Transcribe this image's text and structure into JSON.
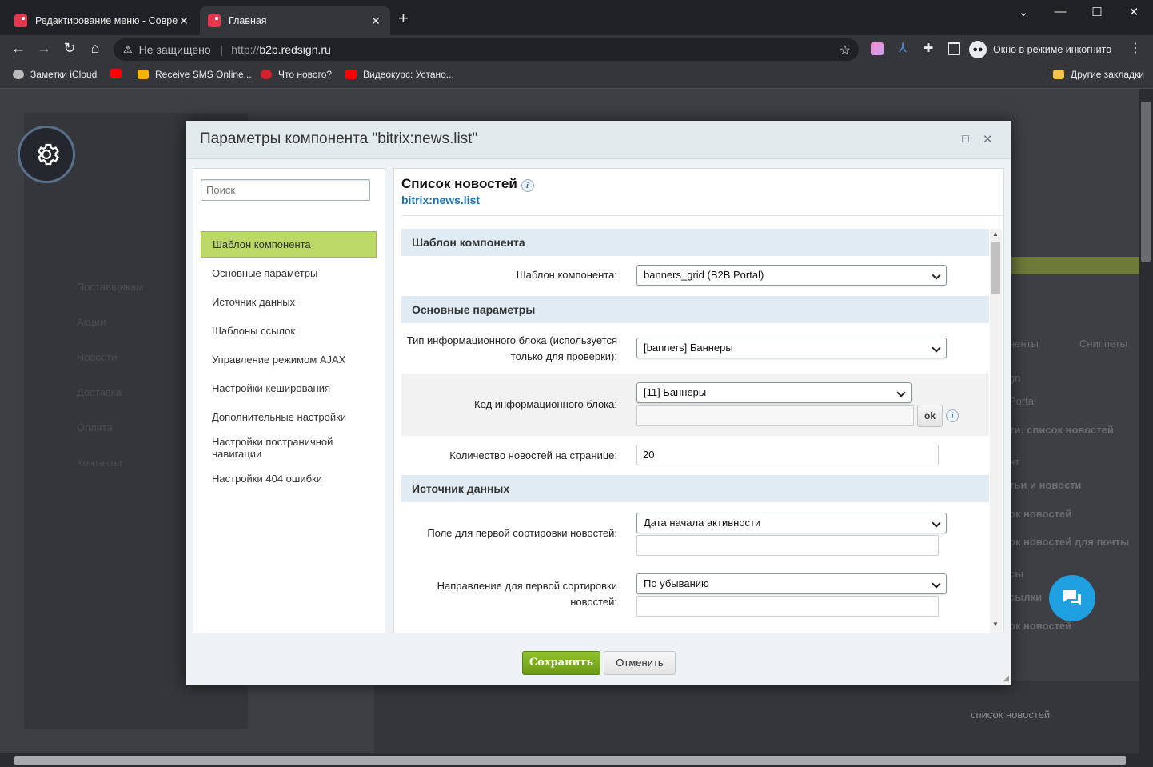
{
  "browser": {
    "tabs": [
      {
        "title": "Редактирование меню - Совре",
        "active": false
      },
      {
        "title": "Главная",
        "active": true
      }
    ],
    "omnibox": {
      "security": "Не защищено",
      "url_prefix": "http://",
      "url_host": "b2b.redsign.ru"
    },
    "incognito_label": "Окно в режиме инкогнито",
    "bookmarks": [
      "Заметки iCloud",
      "Receive SMS Online...",
      "Что нового?",
      "Видеокурс: Устано..."
    ],
    "other_bookmarks": "Другие закладки"
  },
  "background": {
    "sidebar_items": [
      "Поставщикам",
      "Акции",
      "Новости",
      "Доставка",
      "Оплата",
      "Контакты"
    ],
    "right_texts": [
      "ненты",
      "Сниппеты",
      "gn",
      "Portal",
      "ти: список новостей",
      "нт",
      "тьи и новости",
      "ок новостей",
      "ок новостей для почты",
      "сы",
      "сылки",
      "ок новостей",
      "список новостей"
    ]
  },
  "dialog": {
    "title": "Параметры компонента \"bitrix:news.list\"",
    "search_placeholder": "Поиск",
    "nav": [
      "Шаблон компонента",
      "Основные параметры",
      "Источник данных",
      "Шаблоны ссылок",
      "Управление режимом AJAX",
      "Настройки кеширования",
      "Дополнительные настройки",
      "Настройки постраничной навигации",
      "Настройки 404 ошибки"
    ],
    "component_title": "Список новостей",
    "component_code": "bitrix:news.list",
    "sections": {
      "template": "Шаблон компонента",
      "basic": "Основные параметры",
      "source": "Источник данных"
    },
    "fields": {
      "template_label": "Шаблон компонента:",
      "template_value": "banners_grid (B2B Portal)",
      "iblock_type_label": "Тип информационного блока (используется только для проверки):",
      "iblock_type_value": "[banners] Баннеры",
      "iblock_code_label": "Код информационного блока:",
      "iblock_code_value": "[11] Баннеры",
      "iblock_code_input": "",
      "ok_label": "ok",
      "news_count_label": "Количество новостей на странице:",
      "news_count_value": "20",
      "sort1_label": "Поле для первой сортировки новостей:",
      "sort1_value": "Дата начала активности",
      "sort1_input": "",
      "order1_label": "Направление для первой сортировки новостей:",
      "order1_value": "По убыванию",
      "order1_input": ""
    },
    "save_label": "Сохранить",
    "cancel_label": "Отменить"
  },
  "colors": {
    "save": "#7aad1f",
    "active_nav": "#bcd866",
    "section_bg": "#e1ebf3",
    "chat_fab": "#1fa0e0"
  }
}
